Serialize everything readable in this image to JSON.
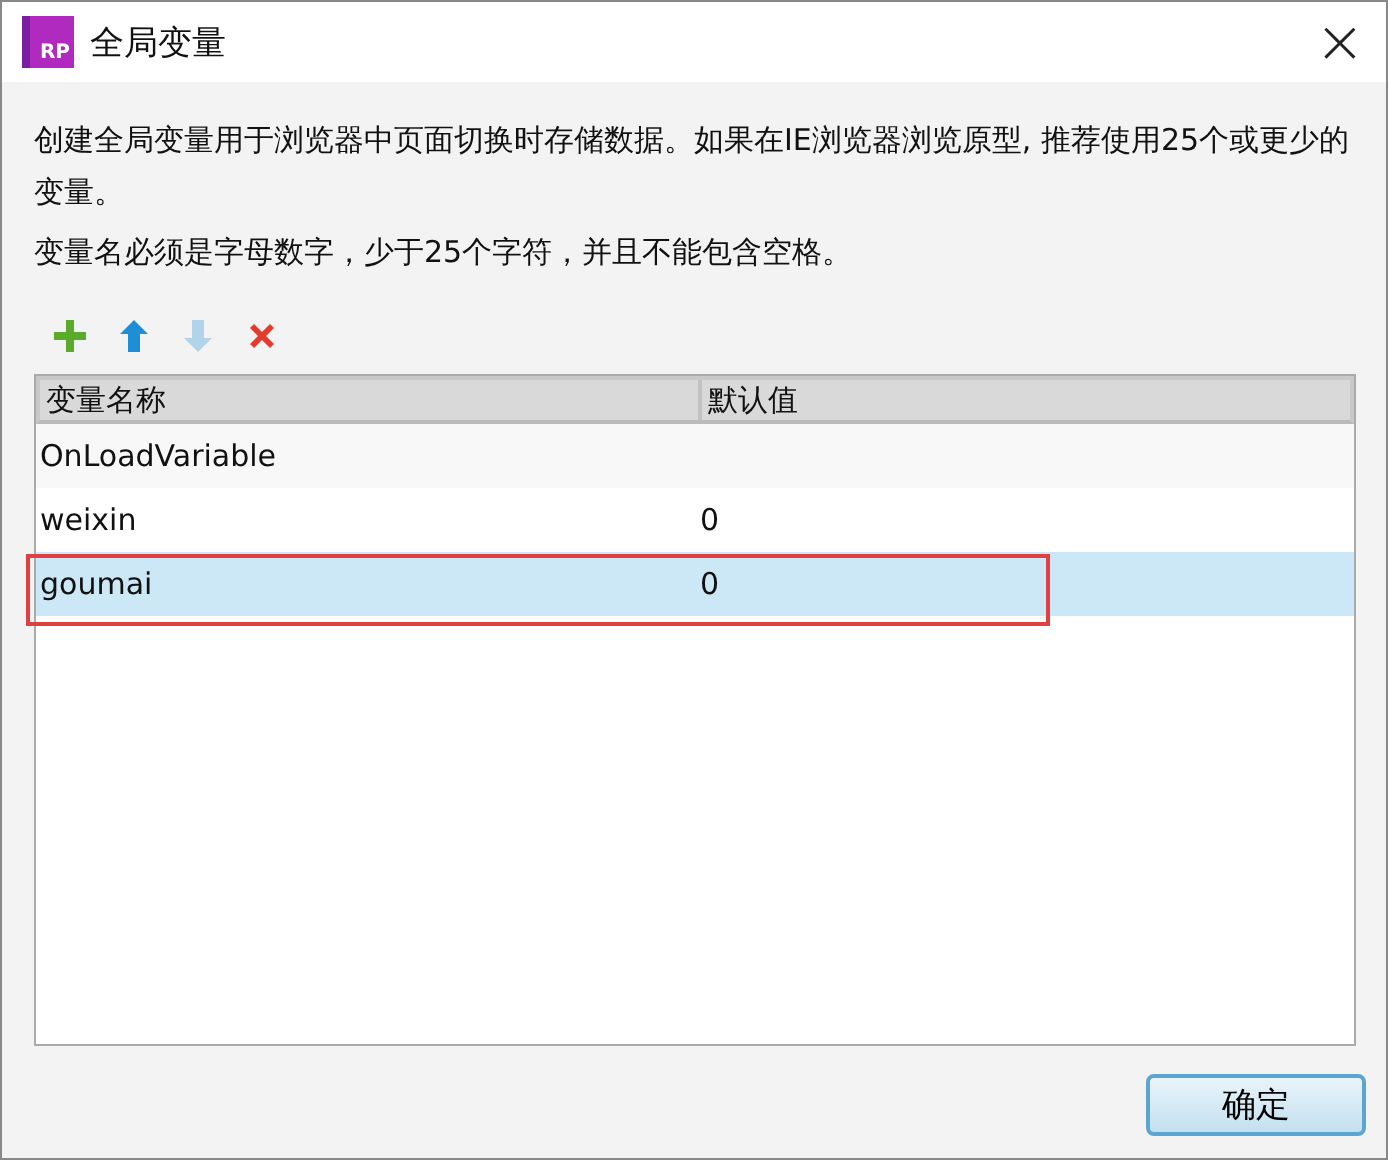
{
  "window": {
    "title": "全局变量",
    "app_icon_text": "RP",
    "close": "×"
  },
  "description": [
    "创建全局变量用于浏览器中页面切换时存储数据。如果在IE浏览器浏览原型, 推荐使用25个或更少的变量。",
    "变量名必须是字母数字，少于25个字符，并且不能包含空格。"
  ],
  "toolbar": [
    {
      "kind": "add",
      "disabled": false
    },
    {
      "kind": "up",
      "disabled": false
    },
    {
      "kind": "down",
      "disabled": true
    },
    {
      "kind": "delete",
      "disabled": false
    }
  ],
  "table": {
    "columns": [
      "变量名称",
      "默认值"
    ],
    "rows": [
      {
        "name": "OnLoadVariable",
        "value": "",
        "selected": false,
        "highlighted": false
      },
      {
        "name": "weixin",
        "value": "0",
        "selected": false,
        "highlighted": false
      },
      {
        "name": "goumai",
        "value": "0",
        "selected": true,
        "highlighted": true
      }
    ]
  },
  "buttons": [
    "确定"
  ]
}
